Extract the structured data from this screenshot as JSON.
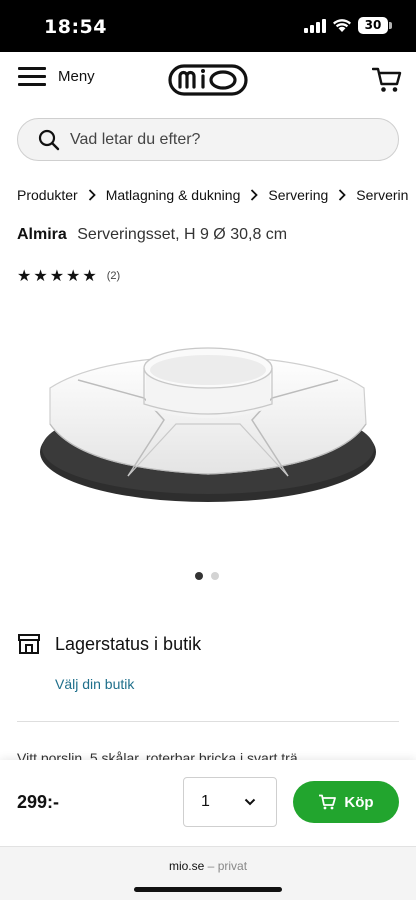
{
  "status_bar": {
    "time": "18:54",
    "battery": "30"
  },
  "header": {
    "menu_label": "Meny",
    "logo_text": "mio",
    "cart_icon": "cart-icon"
  },
  "search": {
    "placeholder": "Vad letar du efter?"
  },
  "breadcrumb": [
    "Produkter",
    "Matlagning & dukning",
    "Servering",
    "Serverin"
  ],
  "product": {
    "brand": "Almira",
    "subtitle": "Serveringsset, H 9 Ø 30,8 cm",
    "stars": "★★★★★",
    "rating_value": 5,
    "review_count": "(2)",
    "image_count": 2,
    "active_image": 1,
    "description_partial": "Vitt porslin, 5 skålar, roterbar bricka i svart trä"
  },
  "store": {
    "title": "Lagerstatus i butik",
    "link": "Välj din butik"
  },
  "buy_bar": {
    "price": "299:-",
    "quantity": "1",
    "buy_label": "Köp"
  },
  "browser": {
    "domain": "mio.se",
    "separator": "–",
    "mode": "privat"
  },
  "colors": {
    "buy_green": "#22a52e",
    "link_teal": "#1f6f8b"
  }
}
